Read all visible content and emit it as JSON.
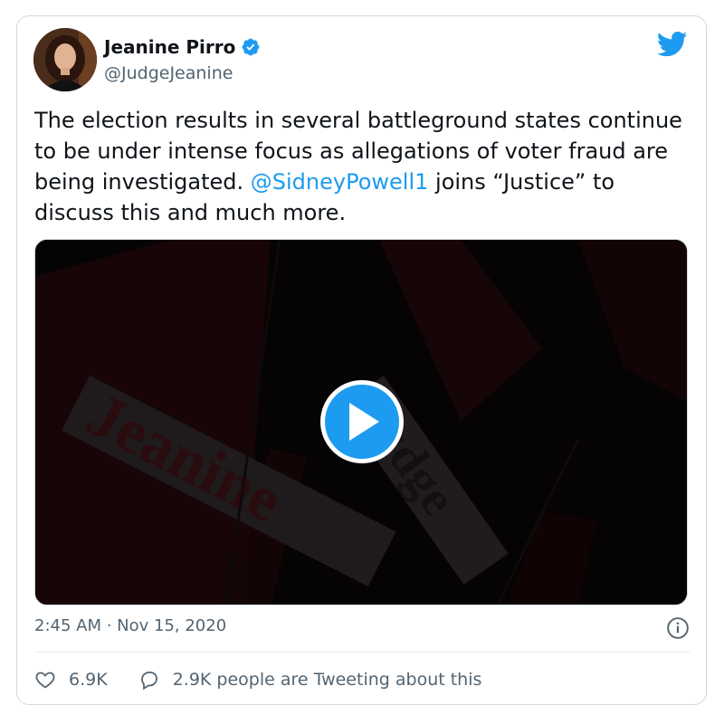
{
  "tweet": {
    "author_name": "Jeanine Pirro",
    "handle": "@JudgeJeanine",
    "text_before": "The election results in several battleground states continue to be under intense focus as allegations of voter fraud are being investigated. ",
    "mention": "@SidneyPowell1",
    "text_after": " joins “Justice” to discuss this and much more.",
    "timestamp": "2:45 AM · Nov 15, 2020",
    "likes": "6.9K",
    "tweeting_label": "2.9K people are Tweeting about this"
  },
  "media": {
    "overlay_text_1": "Jeanine",
    "overlay_text_2": "Judge"
  },
  "icons": {
    "verified": "verified-badge-icon",
    "bird": "twitter-bird-icon",
    "play": "play-icon",
    "info": "info-icon",
    "like": "heart-icon",
    "reply": "speech-bubble-icon"
  },
  "colors": {
    "accent": "#1d9bf0",
    "text": "#0f1419",
    "secondary": "#536471"
  }
}
